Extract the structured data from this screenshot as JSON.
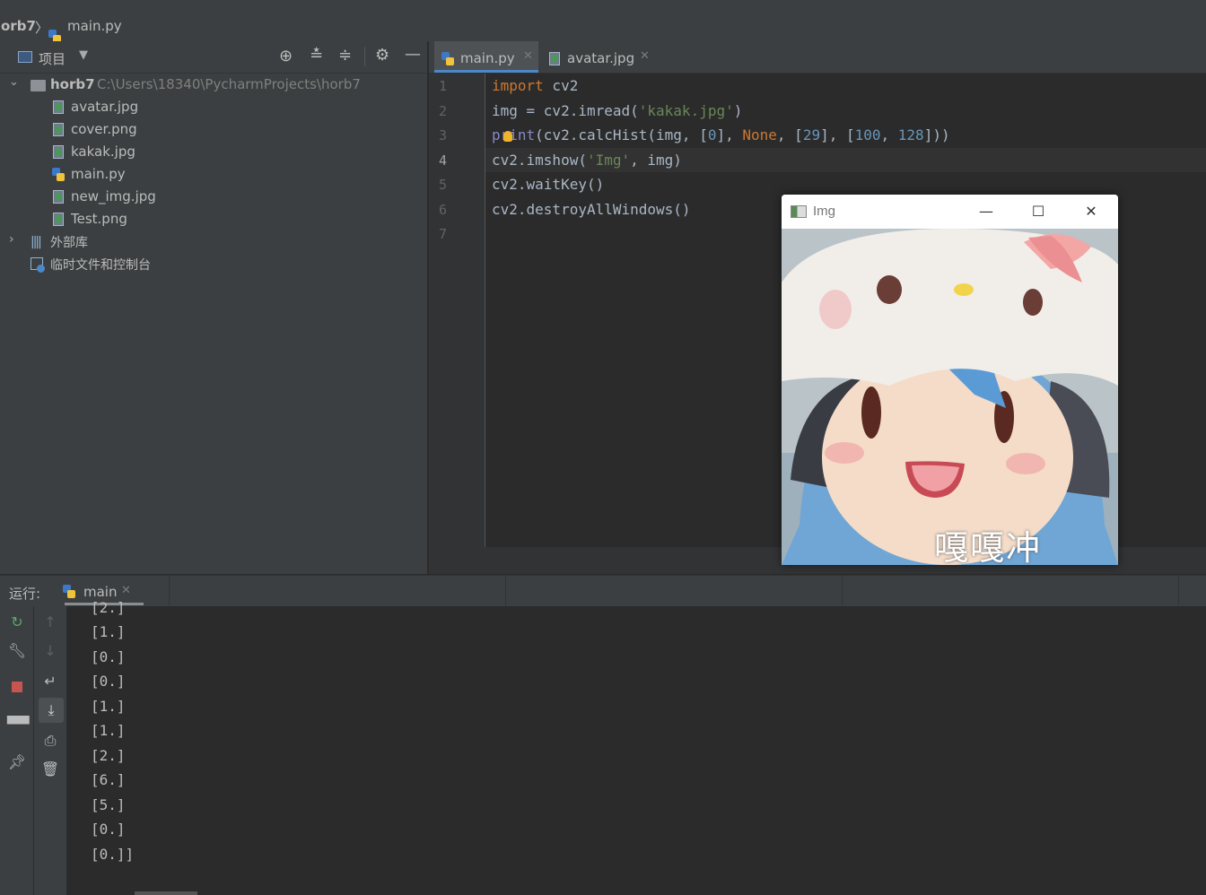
{
  "colors": {
    "keyword": "#cc7832",
    "string": "#6a8759",
    "number": "#6897bb",
    "builtin": "#8888c6",
    "text": "#a9b7c6",
    "accent": "#4a88c7"
  },
  "navbar": {
    "project_crumb": "orb7",
    "separator": "〉",
    "file_crumb": "main.py"
  },
  "project_panel": {
    "title": "项目",
    "root": {
      "name": "horb7",
      "path": "C:\\Users\\18340\\PycharmProjects\\horb7"
    },
    "files": [
      "avatar.jpg",
      "cover.png",
      "kakak.jpg",
      "main.py",
      "new_img.jpg",
      "Test.png"
    ],
    "external_libs": "外部库",
    "scratches": "临时文件和控制台"
  },
  "editor": {
    "tabs": [
      {
        "label": "main.py",
        "active": true
      },
      {
        "label": "avatar.jpg",
        "active": false
      }
    ],
    "line_numbers": [
      "1",
      "2",
      "3",
      "4",
      "5",
      "6",
      "7"
    ],
    "current_line": "4",
    "code": {
      "l1_kw": "import",
      "l1_rest": " cv2",
      "l2_a": "img = cv2.imread(",
      "l2_str": "'kakak.jpg'",
      "l2_b": ")",
      "l3_print": "print",
      "l3_a": "(cv2.calcHist(img, [",
      "l3_n0": "0",
      "l3_b": "], ",
      "l3_none": "None",
      "l3_c": ", [",
      "l3_n29": "29",
      "l3_d": "], [",
      "l3_n100": "100",
      "l3_e": ", ",
      "l3_n128": "128",
      "l3_f": "]))",
      "l4_a": "cv2.imshow(",
      "l4_str": "'Img'",
      "l4_b": ", img)",
      "l5": "cv2.waitKey()",
      "l6": "cv2.destroyAllWindows()"
    }
  },
  "image_window": {
    "title": "Img",
    "minimize": "—",
    "maximize": "☐",
    "close": "✕",
    "caption": "嘎嘎冲"
  },
  "run_panel": {
    "label": "运行:",
    "tab": "main",
    "output_lines": [
      "[2.]",
      "[1.]",
      "[0.]",
      "[0.]",
      "[1.]",
      "[1.]",
      "[2.]",
      "[6.]",
      "[5.]",
      "[0.]",
      "[0.]]"
    ]
  }
}
